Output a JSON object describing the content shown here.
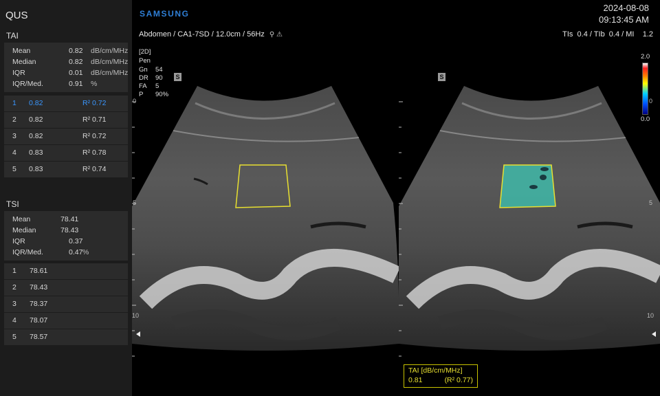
{
  "app": {
    "title": "QUS",
    "brand": "SAMSUNG"
  },
  "datetime": {
    "date": "2024-08-08",
    "time": "09:13:45 AM"
  },
  "probe_info": "Abdomen / CA1-7SD / 12.0cm / 56Hz",
  "ti_info": "TIs  0.4 / TIb  0.4 / MI    1.2",
  "params": {
    "mode": "[2D]",
    "pen": "Pen",
    "rows": [
      {
        "label": "Gn",
        "value": "54"
      },
      {
        "label": "DR",
        "value": "90"
      },
      {
        "label": "FA",
        "value": "5"
      },
      {
        "label": "P",
        "value": "90%"
      }
    ]
  },
  "badge": "S",
  "colorbar": {
    "max": "2.0",
    "min": "0.0"
  },
  "depth_marks": {
    "top": "0",
    "mid": "5",
    "bottom": "10"
  },
  "tai": {
    "title": "TAI",
    "summary": [
      {
        "label": "Mean",
        "value": "0.82",
        "unit": "dB/cm/MHz"
      },
      {
        "label": "Median",
        "value": "0.82",
        "unit": "dB/cm/MHz"
      },
      {
        "label": "IQR",
        "value": "0.01",
        "unit": "dB/cm/MHz"
      },
      {
        "label": "IQR/Med.",
        "value": "0.91",
        "unit": "%"
      }
    ],
    "measurements": [
      {
        "n": "1",
        "value": "0.82",
        "r2": "R² 0.72"
      },
      {
        "n": "2",
        "value": "0.82",
        "r2": "R² 0.71"
      },
      {
        "n": "3",
        "value": "0.82",
        "r2": "R² 0.72"
      },
      {
        "n": "4",
        "value": "0.83",
        "r2": "R² 0.78"
      },
      {
        "n": "5",
        "value": "0.83",
        "r2": "R² 0.74"
      }
    ]
  },
  "tsi": {
    "title": "TSI",
    "summary": [
      {
        "label": "Mean",
        "value": "78.41",
        "unit": ""
      },
      {
        "label": "Median",
        "value": "78.43",
        "unit": ""
      },
      {
        "label": "IQR",
        "value": "0.37",
        "unit": ""
      },
      {
        "label": "IQR/Med.",
        "value": "0.47",
        "unit": "%"
      }
    ],
    "measurements": [
      {
        "n": "1",
        "value": "78.61"
      },
      {
        "n": "2",
        "value": "78.43"
      },
      {
        "n": "3",
        "value": "78.37"
      },
      {
        "n": "4",
        "value": "78.07"
      },
      {
        "n": "5",
        "value": "78.57"
      }
    ]
  },
  "result": {
    "title": "TAI [dB/cm/MHz]",
    "value": "0.81",
    "r2": "(R² 0.77)"
  },
  "colors": {
    "accent": "#3a97ff",
    "roi": "#e8e030",
    "brand": "#2f7fd6",
    "map": "#3fb8a8"
  }
}
